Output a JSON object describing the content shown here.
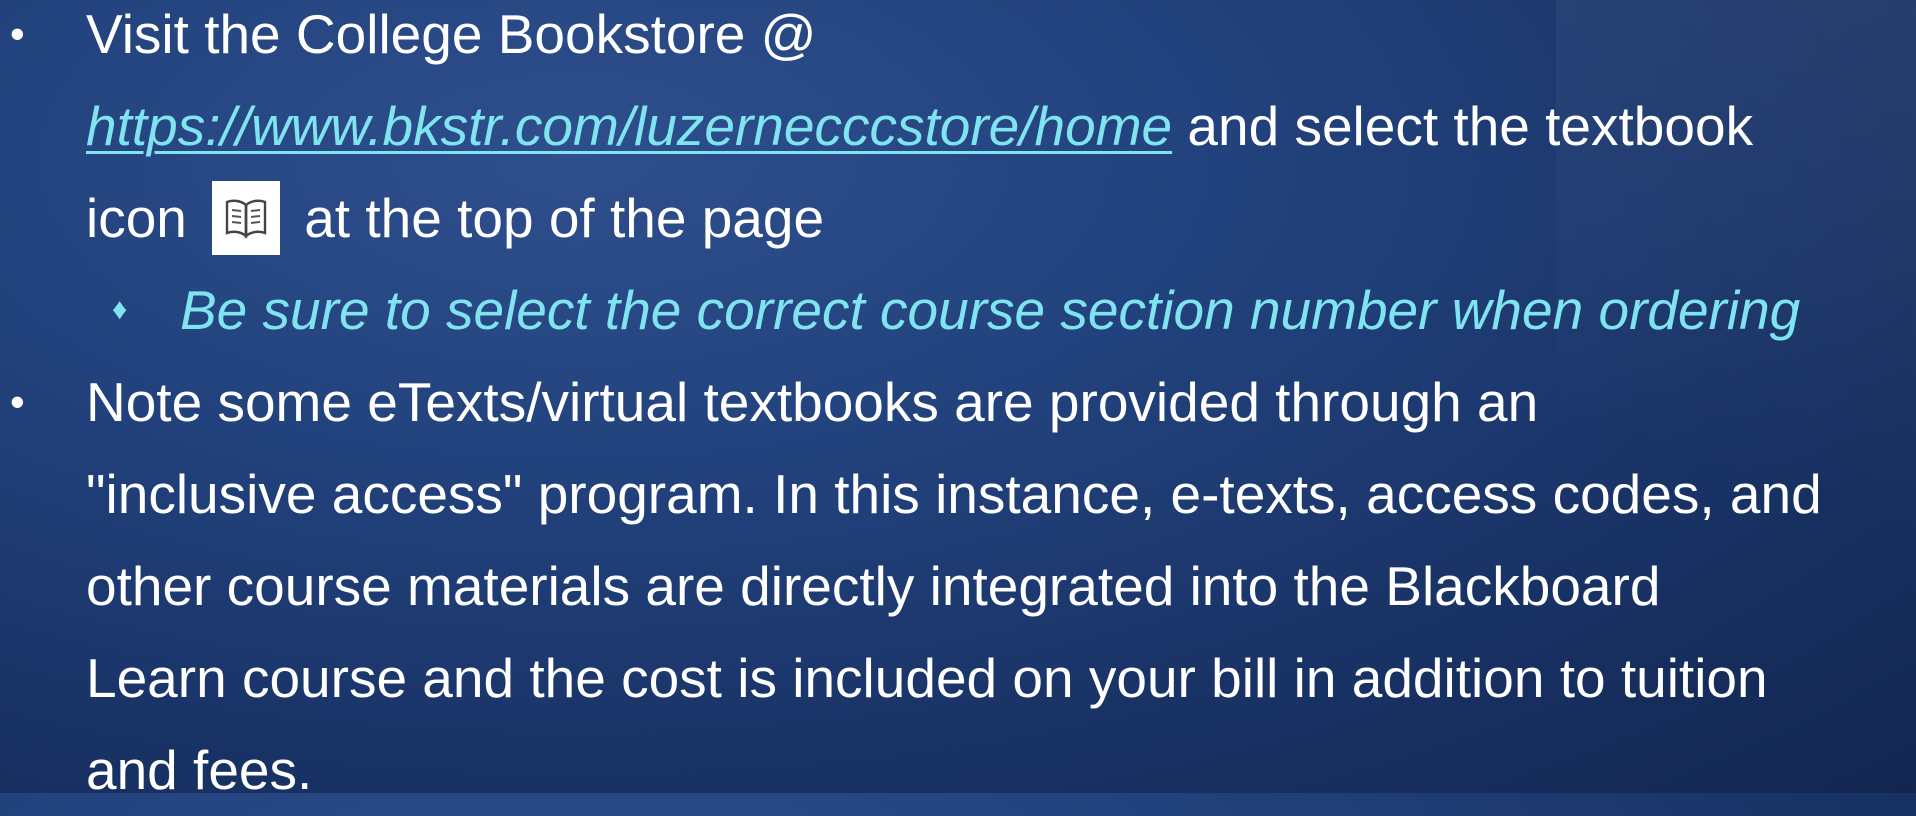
{
  "slide": {
    "bullet1": {
      "line1": "Visit the College Bookstore @",
      "link": "https://www.bkstr.com/luzernecccstore/home",
      "line2_rest": " and select the textbook",
      "line3_pre": "icon",
      "line3_post": "at the top of the page",
      "icon": "textbook-icon"
    },
    "sub_bullet": {
      "text": "Be sure to select the correct course section number when ordering"
    },
    "bullet2": {
      "lines": [
        "Note some eTexts/virtual textbooks are provided through an",
        "\"inclusive access\" program. In this instance, e-texts, access codes, and",
        "other course materials are directly integrated into the Blackboard",
        "Learn course and the cost is included on your bill in addition to tuition",
        "and fees."
      ]
    },
    "bullet_glyph": "•",
    "sub_bullet_glyph": "♦",
    "colors": {
      "background": "#22427d",
      "text": "#ffffff",
      "accent": "#7fe3f0"
    }
  }
}
